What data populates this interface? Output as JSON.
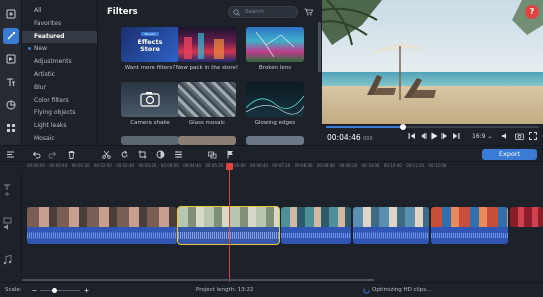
{
  "colors": {
    "accent": "#3a7bd5",
    "playhead": "#e0433f",
    "selection": "#e8c73b",
    "panel": "#1d2129"
  },
  "toolbar_icons": [
    "import-icon",
    "filters-wand-icon",
    "transitions-icon",
    "titles-icon",
    "stickers-icon",
    "more-tools-icon"
  ],
  "categories": [
    {
      "label": "All",
      "dot": false
    },
    {
      "label": "Favorites",
      "dot": false
    },
    {
      "label": "Featured",
      "dot": false,
      "selected": true
    },
    {
      "label": "New",
      "dot": true
    },
    {
      "label": "Adjustments",
      "dot": false
    },
    {
      "label": "Artistic",
      "dot": false
    },
    {
      "label": "Blur",
      "dot": false
    },
    {
      "label": "Color filters",
      "dot": false
    },
    {
      "label": "Flying objects",
      "dot": false
    },
    {
      "label": "Light leaks",
      "dot": false
    },
    {
      "label": "Mosaic",
      "dot": false
    }
  ],
  "filters": {
    "title": "Filters",
    "search_placeholder": "Search",
    "tiles": [
      {
        "label": "Want more filters?",
        "banner_top": "Movavi",
        "banner_main": "Effects Store"
      },
      {
        "label": "New pack in the store!"
      },
      {
        "label": "Broken lens"
      },
      {
        "label": "Camera shake"
      },
      {
        "label": "Glass mosaic"
      },
      {
        "label": "Glowing edges"
      }
    ]
  },
  "preview": {
    "help": "?",
    "timecode": "00:04:46",
    "timecode_ms": "000",
    "progress": 0.36,
    "aspect": "16:9"
  },
  "timeline": {
    "export_label": "Export",
    "ruler": [
      "00:00:00",
      "00:00:40",
      "00:01:20",
      "00:02:00",
      "00:02:40",
      "00:03:20",
      "00:04:00",
      "00:04:40",
      "00:05:20",
      "00:06:00",
      "00:06:40",
      "00:07:20",
      "00:08:00",
      "00:08:40",
      "00:09:20",
      "00:10:00",
      "00:10:40",
      "00:11:20",
      "00:12:00"
    ]
  },
  "status": {
    "scale_label": "Scale:",
    "scale": 0.35,
    "project_length": "Project length:  13:22",
    "optimizing": "Optimizing HD clips..."
  }
}
